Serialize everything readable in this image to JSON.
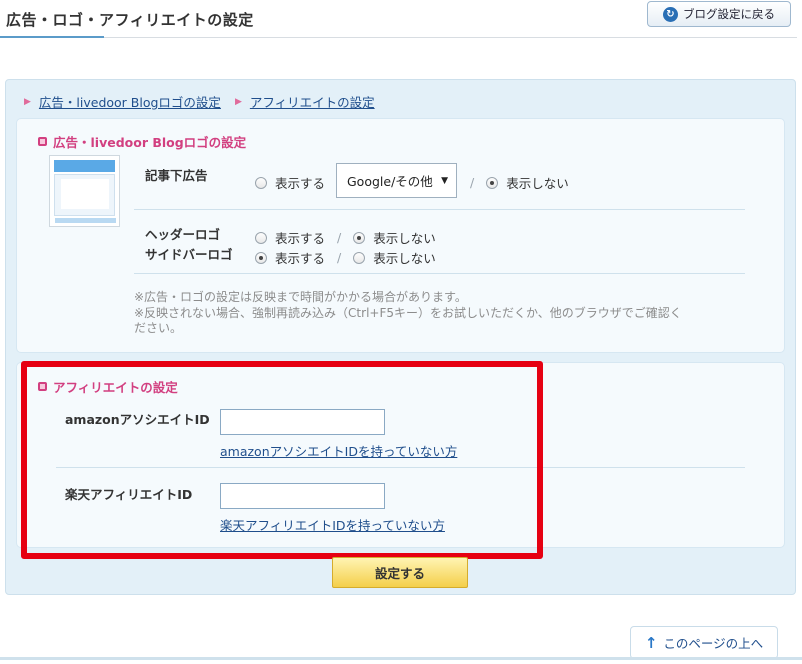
{
  "header": {
    "title": "広告・ロゴ・アフィリエイトの設定",
    "back_button": "ブログ設定に戻る",
    "back_icon": "refresh-arrow-icon"
  },
  "breadcrumb": [
    {
      "label": "広告・livedoor Blogロゴの設定"
    },
    {
      "label": "アフィリエイトの設定"
    }
  ],
  "ad_section": {
    "title": "広告・livedoor Blogロゴの設定",
    "article_ad": {
      "label": "記事下広告",
      "show": "表示する",
      "select_value": "Google/その他",
      "separator": "/",
      "hide": "表示しない",
      "selected": "hide"
    },
    "header_logo": {
      "label": "ヘッダーロゴ",
      "show": "表示する",
      "separator": "/",
      "hide": "表示しない",
      "selected": "hide"
    },
    "sidebar_logo": {
      "label": "サイドバーロゴ",
      "show": "表示する",
      "separator": "/",
      "hide": "表示しない",
      "selected": "show"
    },
    "note_1": "※広告・ロゴの設定は反映まで時間がかかる場合があります。",
    "note_2": "※反映されない場合、強制再読み込み（Ctrl+F5キー）をお試しいただくか、他のブラウザでご確認く",
    "note_3": "ださい。"
  },
  "affiliate_section": {
    "title": "アフィリエイトの設定",
    "amazon": {
      "label": "amazonアソシエイトID",
      "value": "",
      "help_link": "amazonアソシエイトIDを持っていない方"
    },
    "rakuten": {
      "label": "楽天アフィリエイトID",
      "value": "",
      "help_link": "楽天アフィリエイトIDを持っていない方"
    }
  },
  "submit_label": "設定する",
  "page_top_label": "このページの上へ",
  "colors": {
    "accent_pink": "#d23f80",
    "link_blue": "#1f4e8c",
    "panel_bg": "#e3f0f8",
    "highlight_red": "#e60012",
    "submit_yellow": "#f4cf4a"
  }
}
